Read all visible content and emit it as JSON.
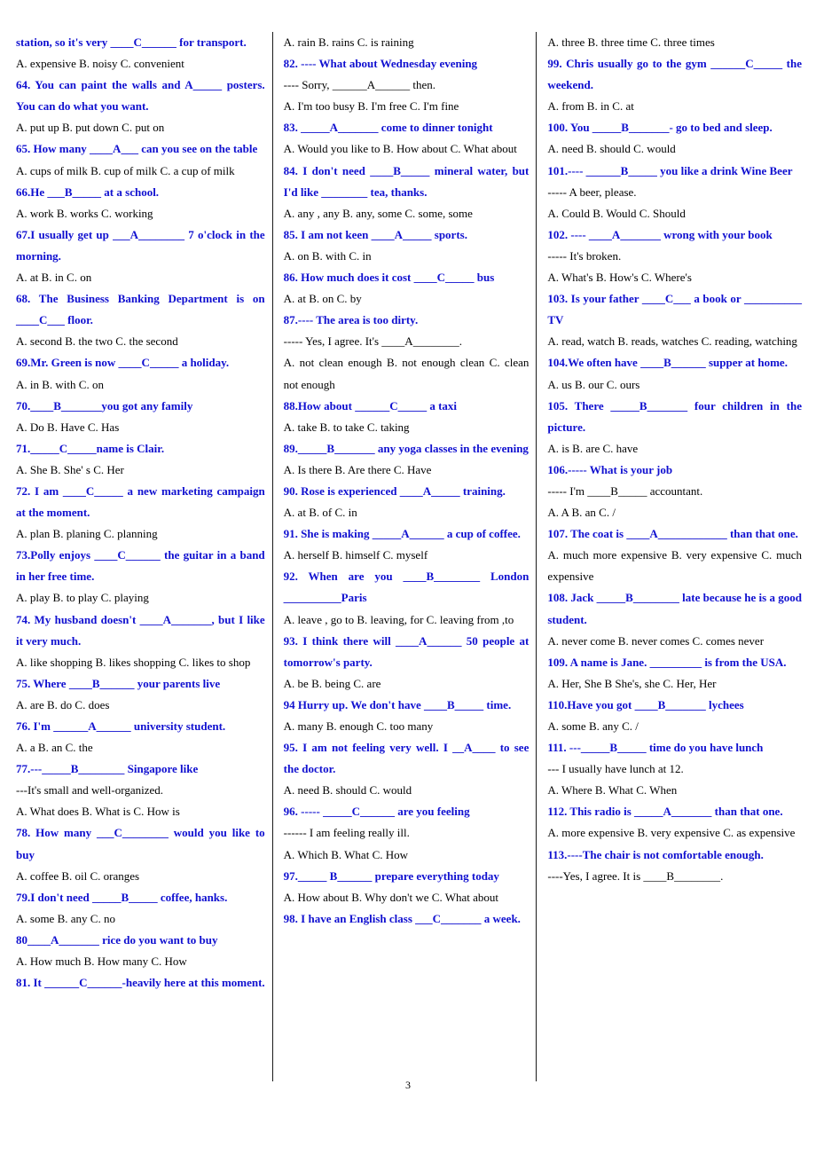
{
  "document": {
    "page_number": "3",
    "colors": {
      "question_blue": "#1010d0",
      "option_black": "#000000"
    }
  },
  "columns": [
    {
      "id": "column-1",
      "lines": [
        {
          "kind": "q",
          "text": "station, so it's very ____C______ for transport."
        },
        {
          "kind": "opt",
          "text": "A. expensive B. noisy C. convenient"
        },
        {
          "kind": "q",
          "text": "64. You can paint the walls and A_____ posters. You can do what you want."
        },
        {
          "kind": "opt",
          "text": "A. put up B. put down C. put on"
        },
        {
          "kind": "q",
          "text": "65. How many ____A___ can you see on the table"
        },
        {
          "kind": "opt",
          "text": "A. cups of milk B. cup of milk C. a cup of milk"
        },
        {
          "kind": "q",
          "text": "66.He ___B_____ at a school."
        },
        {
          "kind": "opt",
          "text": "A. work B. works C. working"
        },
        {
          "kind": "q",
          "text": "67.I usually get up ___A________ 7 o'clock in the morning."
        },
        {
          "kind": "opt",
          "text": "A. at B. in C. on"
        },
        {
          "kind": "q",
          "text": "68. The Business Banking Department is on ____C___ floor."
        },
        {
          "kind": "opt",
          "text": "A. second B. the two C. the second"
        },
        {
          "kind": "q",
          "text": "69.Mr. Green is now ____C_____ a holiday."
        },
        {
          "kind": "opt",
          "text": "A. in B. with C. on"
        },
        {
          "kind": "q",
          "text": "70.____B_______you got any family"
        },
        {
          "kind": "opt",
          "text": "A. Do B. Have C. Has"
        },
        {
          "kind": "q",
          "text": "71._____C_____name is Clair."
        },
        {
          "kind": "opt",
          "text": "A. She B. She' s C. Her"
        },
        {
          "kind": "q",
          "text": "72. I am ____C_____ a new marketing campaign at the moment."
        },
        {
          "kind": "opt",
          "text": "A. plan B. planing C. planning"
        },
        {
          "kind": "q",
          "text": "73.Polly enjoys ____C______ the guitar in a band in her free time."
        },
        {
          "kind": "opt",
          "text": "A. play B. to play C. playing"
        },
        {
          "kind": "q",
          "text": "74. My husband doesn't ____A_______, but I like it very much."
        },
        {
          "kind": "opt",
          "text": "A. like shopping B. likes shopping C. likes to shop"
        },
        {
          "kind": "q",
          "text": "75. Where ____B______ your parents live"
        },
        {
          "kind": "opt",
          "text": "A. are B. do C. does"
        },
        {
          "kind": "q",
          "text": "76. I'm ______A______ university student."
        },
        {
          "kind": "opt",
          "text": "A. a B. an C. the"
        },
        {
          "kind": "q",
          "text": "77.---_____B________ Singapore like"
        },
        {
          "kind": "opt",
          "text": "---It's small and well-organized."
        },
        {
          "kind": "opt",
          "text": "A. What does B. What is C. How is"
        },
        {
          "kind": "q",
          "text": "78. How many ___C________ would you like to buy"
        },
        {
          "kind": "opt",
          "text": "A. coffee B. oil C. oranges"
        },
        {
          "kind": "q",
          "text": "79.I don't need _____B_____ coffee, hanks."
        },
        {
          "kind": "opt",
          "text": "A. some B. any C. no"
        },
        {
          "kind": "q",
          "text": "80____A_______ rice do you want to buy"
        },
        {
          "kind": "opt",
          "text": "A. How much B. How many C. How"
        },
        {
          "kind": "q",
          "text": "81. It ______C______-heavily here at this moment."
        }
      ]
    },
    {
      "id": "column-2",
      "lines": [
        {
          "kind": "opt",
          "text": "A. rain B. rains C. is raining"
        },
        {
          "kind": "q",
          "text": "82. ---- What about Wednesday evening"
        },
        {
          "kind": "opt",
          "text": "---- Sorry, ______A______ then."
        },
        {
          "kind": "opt",
          "text": "A. I'm too busy B. I'm free C. I'm fine"
        },
        {
          "kind": "q",
          "text": "83. _____A_______ come to dinner tonight"
        },
        {
          "kind": "opt",
          "text": "A. Would you like to B. How about C. What about"
        },
        {
          "kind": "q",
          "text": "84. I don't need ____B_____ mineral water, but I'd like ________ tea, thanks."
        },
        {
          "kind": "opt",
          "text": "A. any , any B. any, some C. some, some"
        },
        {
          "kind": "q",
          "text": "85. I am not keen ____A_____ sports."
        },
        {
          "kind": "opt",
          "text": "A. on B. with C. in"
        },
        {
          "kind": "q",
          "text": "86. How much does it cost ____C_____ bus"
        },
        {
          "kind": "opt",
          "text": "A. at B. on C. by"
        },
        {
          "kind": "q",
          "text": "87.---- The area is too dirty."
        },
        {
          "kind": "opt",
          "text": "----- Yes, I agree. It's ____A________."
        },
        {
          "kind": "opt",
          "text": "A. not clean enough B. not enough clean C. clean not enough"
        },
        {
          "kind": "q",
          "text": "88.How about ______C_____ a taxi"
        },
        {
          "kind": "opt",
          "text": "A. take B. to take C. taking"
        },
        {
          "kind": "q",
          "text": "89._____B_______ any yoga classes in the evening"
        },
        {
          "kind": "opt",
          "text": "A. Is there B. Are there C. Have"
        },
        {
          "kind": "q",
          "text": "90. Rose is experienced ____A_____ training."
        },
        {
          "kind": "opt",
          "text": "A. at B. of C. in"
        },
        {
          "kind": "q",
          "text": "91. She is making _____A______ a cup of coffee."
        },
        {
          "kind": "opt",
          "text": "A. herself B. himself C. myself"
        },
        {
          "kind": "q",
          "text": "92. When are you ____B________ London __________Paris"
        },
        {
          "kind": "opt",
          "text": "A. leave , go to B. leaving, for C. leaving from ,to"
        },
        {
          "kind": "q",
          "text": "93. I think there will ____A______ 50 people at tomorrow's party."
        },
        {
          "kind": "opt",
          "text": "A. be B. being C. are"
        },
        {
          "kind": "q",
          "text": "94 Hurry up. We don't have ____B_____ time."
        },
        {
          "kind": "opt",
          "text": "A. many B. enough C. too many"
        },
        {
          "kind": "q",
          "text": "95. I am not feeling very well. I __A____ to see the doctor."
        },
        {
          "kind": "opt",
          "text": "A. need B. should C. would"
        },
        {
          "kind": "q",
          "text": "96. ----- _____C______ are you feeling"
        },
        {
          "kind": "opt",
          "text": "------ I am feeling really ill."
        },
        {
          "kind": "opt",
          "text": "A. Which B. What C. How"
        },
        {
          "kind": "q",
          "text": "97._____ B______ prepare everything today"
        },
        {
          "kind": "opt",
          "text": "A. How about B. Why don't we C. What about"
        },
        {
          "kind": "q",
          "text": "98. I have an English class ___C_______ a week."
        }
      ]
    },
    {
      "id": "column-3",
      "lines": [
        {
          "kind": "opt",
          "text": "A. three B. three time C. three times"
        },
        {
          "kind": "q",
          "text": "99. Chris usually go to the gym ______C_____ the weekend."
        },
        {
          "kind": "opt",
          "text": "A. from B. in C. at"
        },
        {
          "kind": "q",
          "text": "100. You _____B_______- go to bed and sleep."
        },
        {
          "kind": "opt",
          "text": "A. need B. should C. would"
        },
        {
          "kind": "q",
          "text": "101.---- ______B_____ you like a drink Wine Beer"
        },
        {
          "kind": "opt",
          "text": "----- A beer, please."
        },
        {
          "kind": "opt",
          "text": "A. Could B. Would C. Should"
        },
        {
          "kind": "q",
          "text": "102. ---- ____A_______ wrong with your book"
        },
        {
          "kind": "opt",
          "text": "----- It's broken."
        },
        {
          "kind": "opt",
          "text": "A. What's B. How's C. Where's"
        },
        {
          "kind": "q",
          "text": "103. Is your father ____C___ a book or __________ TV"
        },
        {
          "kind": "opt",
          "text": "A. read, watch B. reads, watches C. reading, watching"
        },
        {
          "kind": "q",
          "text": "104.We often have ____B______ supper at home."
        },
        {
          "kind": "opt",
          "text": "A. us B. our C. ours"
        },
        {
          "kind": "q",
          "text": "105. There _____B_______ four children in the picture."
        },
        {
          "kind": "opt",
          "text": "A. is B. are C. have"
        },
        {
          "kind": "q",
          "text": "106.----- What is your job"
        },
        {
          "kind": "opt",
          "text": "----- I'm ____B_____ accountant."
        },
        {
          "kind": "opt",
          "text": "A. A B. an C. /"
        },
        {
          "kind": "q",
          "text": "107. The coat is ____A____________ than that one."
        },
        {
          "kind": "opt",
          "text": "A. much more expensive B. very expensive C. much expensive"
        },
        {
          "kind": "q",
          "text": "108. Jack _____B________ late because he is a good student."
        },
        {
          "kind": "opt",
          "text": "A. never come B. never comes C. comes never"
        },
        {
          "kind": "q",
          "text": "109. A name is Jane. _________ is from the USA."
        },
        {
          "kind": "opt",
          "text": "A. Her, She B She's, she C. Her, Her"
        },
        {
          "kind": "q",
          "text": "110.Have you got ____B_______ lychees"
        },
        {
          "kind": "opt",
          "text": "A. some B. any C. /"
        },
        {
          "kind": "q",
          "text": "111. ---_____B_____ time do you have lunch"
        },
        {
          "kind": "opt",
          "text": "--- I usually have lunch at 12."
        },
        {
          "kind": "opt",
          "text": "A. Where B. What C. When"
        },
        {
          "kind": "q",
          "text": "112. This radio is _____A_______ than that one."
        },
        {
          "kind": "opt",
          "text": "A. more expensive B. very expensive C. as expensive"
        },
        {
          "kind": "q",
          "text": "113.----The chair is not comfortable enough."
        },
        {
          "kind": "opt",
          "text": "----Yes, I agree. It is ____B________."
        }
      ]
    }
  ]
}
